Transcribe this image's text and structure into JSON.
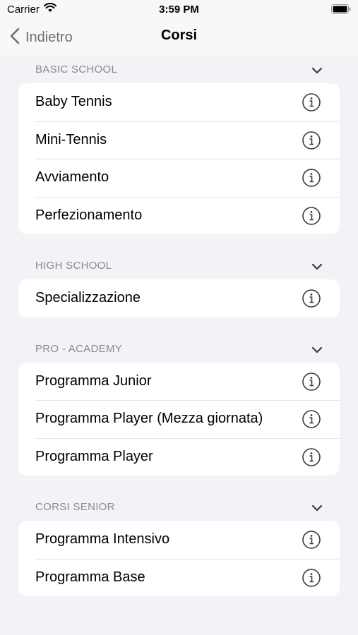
{
  "status_bar": {
    "carrier": "Carrier",
    "time": "3:59 PM"
  },
  "nav": {
    "back_label": "Indietro",
    "title": "Corsi"
  },
  "colors": {
    "background": "#f2f2f7",
    "card": "#ffffff",
    "secondary_text": "#8a8a8e"
  },
  "icons": {
    "row": "info-circle-icon",
    "section": "chevron-down-icon",
    "back": "chevron-left-icon"
  },
  "sections": [
    {
      "title": "BASIC SCHOOL",
      "items": [
        "Baby Tennis",
        "Mini-Tennis",
        "Avviamento",
        "Perfezionamento"
      ]
    },
    {
      "title": "HIGH SCHOOL",
      "items": [
        "Specializzazione"
      ]
    },
    {
      "title": "PRO - ACADEMY",
      "items": [
        "Programma Junior",
        "Programma Player (Mezza giornata)",
        "Programma Player"
      ]
    },
    {
      "title": "CORSI SENIOR",
      "items": [
        "Programma Intensivo",
        "Programma Base"
      ]
    }
  ]
}
